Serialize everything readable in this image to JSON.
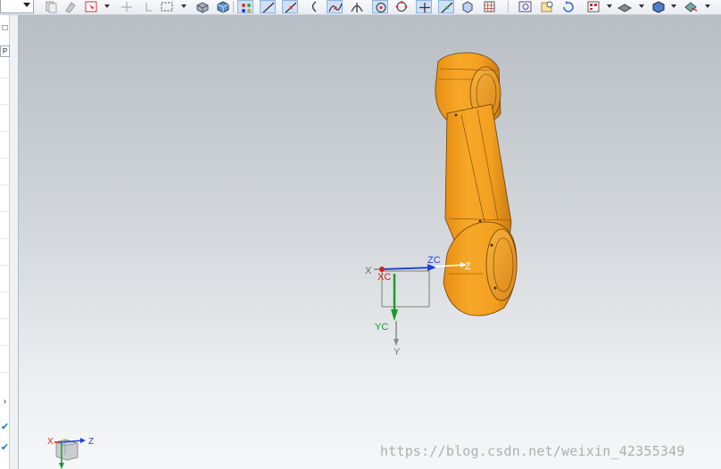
{
  "toolbar": {
    "icons": [
      "copy-icon",
      "paste-icon",
      "select-filter-icon",
      "snap-point-icon",
      "grab-icon",
      "box-select-icon",
      "shaded-view-icon",
      "cube-view-icon",
      "point-snap-icon",
      "line-snap-icon",
      "end-point-icon",
      "arc-icon",
      "curve-point-icon",
      "intersect-icon",
      "center-icon",
      "quadrant-icon",
      "cross-icon",
      "midpoint-icon",
      "grid-icon",
      "fit-view-icon",
      "zoom-icon",
      "rotate-icon",
      "layer-icon",
      "render-icon",
      "display-icon",
      "more-icon"
    ]
  },
  "leftbar": {
    "tab_glyph": "□",
    "tab2_glyph": "P",
    "expand_glyph": "›",
    "check_glyph": "✔"
  },
  "viewport": {
    "model_color": "#f0a020",
    "model_shadow": "#c9801a",
    "wcs": {
      "x_label": "X",
      "xc_label": "XC",
      "zc_label": "ZC",
      "z_label": "Z",
      "yc_label": "YC",
      "y_label": "Y"
    },
    "triad": {
      "x_label": "X",
      "z_label": "Z"
    },
    "watermark": "https://blog.csdn.net/weixin_42355349"
  }
}
